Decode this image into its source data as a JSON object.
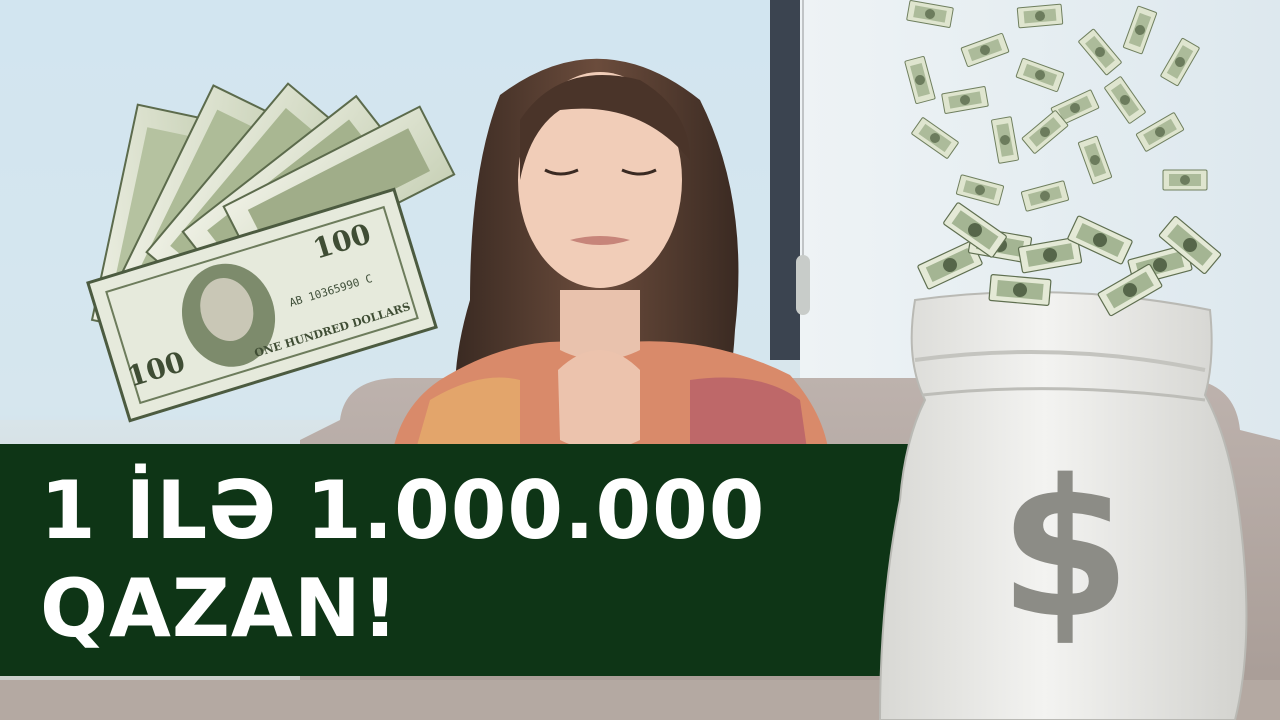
{
  "headline": {
    "line1": "1 İLƏ 1.000.000",
    "line2": "QAZAN!"
  },
  "money": {
    "fan_note_label": "100",
    "fan_note_serial": "AB 10365990 C",
    "fan_note_text": "ONE HUNDRED DOLLARS",
    "bag_symbol": "$"
  },
  "colors": {
    "banner": "#0e3516",
    "headline_text": "#ffffff",
    "bill_green": "#8fa57c",
    "bag": "#ececea",
    "bag_symbol": "#8c8c86"
  }
}
